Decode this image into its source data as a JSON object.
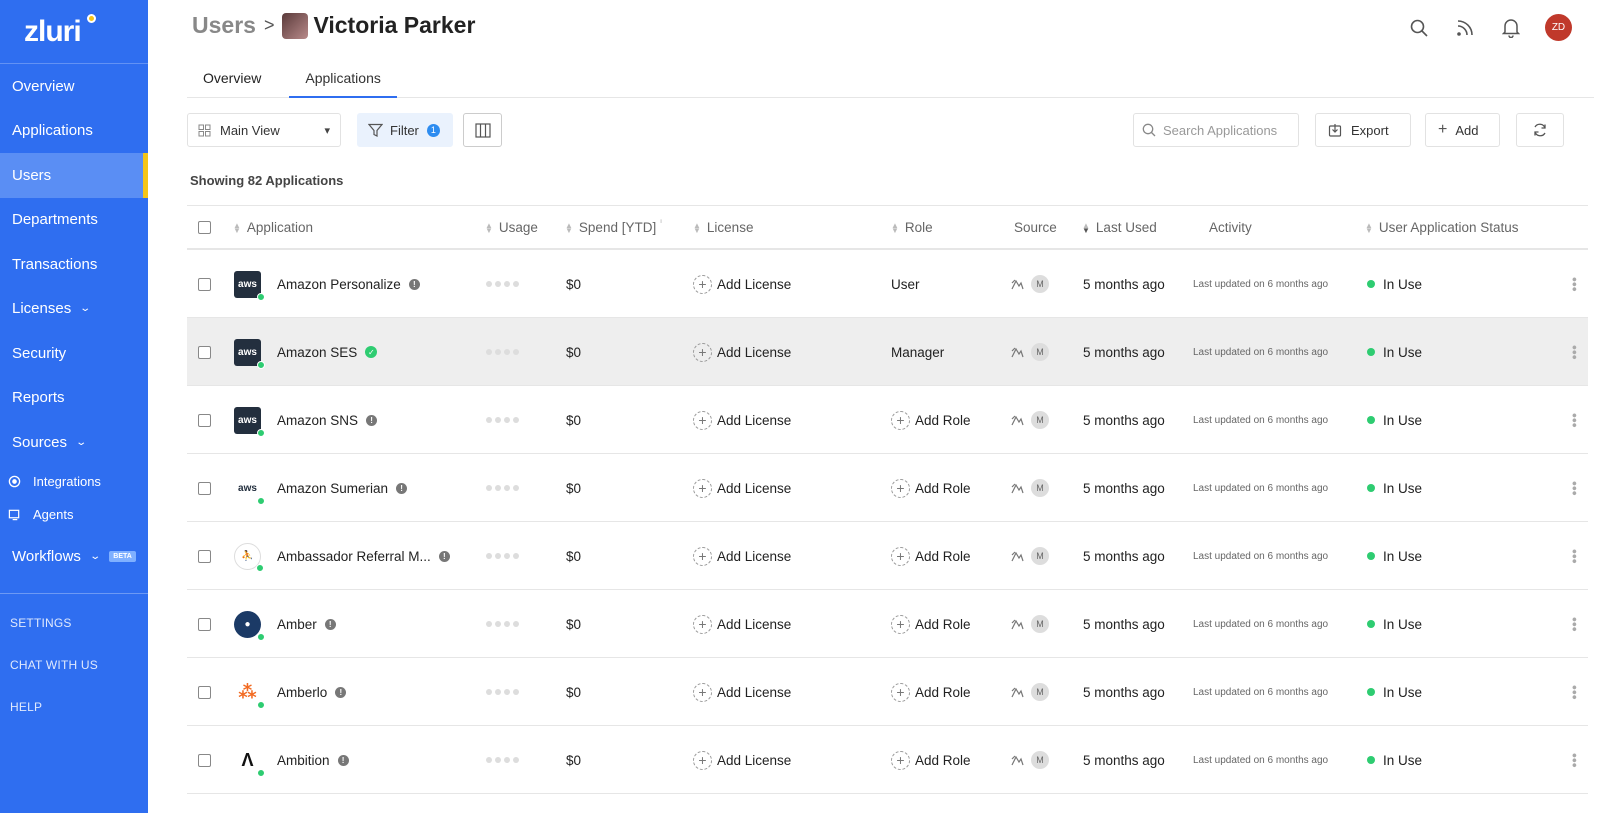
{
  "app": {
    "logo_text": "zluri"
  },
  "sidebar": {
    "items": [
      {
        "label": "Overview"
      },
      {
        "label": "Applications"
      },
      {
        "label": "Users"
      },
      {
        "label": "Departments"
      },
      {
        "label": "Transactions"
      },
      {
        "label": "Licenses"
      },
      {
        "label": "Security"
      },
      {
        "label": "Reports"
      },
      {
        "label": "Sources"
      }
    ],
    "sub_items": [
      {
        "label": "Integrations"
      },
      {
        "label": "Agents"
      }
    ],
    "workflows": {
      "label": "Workflows",
      "badge": "BETA"
    },
    "footer": [
      {
        "label": "SETTINGS"
      },
      {
        "label": "CHAT WITH US"
      },
      {
        "label": "HELP"
      }
    ]
  },
  "header": {
    "breadcrumb_root": "Users",
    "breadcrumb_sep": ">",
    "user_name": "Victoria Parker",
    "avatar_initials": "ZD"
  },
  "tabs": [
    {
      "label": "Overview"
    },
    {
      "label": "Applications"
    }
  ],
  "toolbar": {
    "view_label": "Main View",
    "filter_label": "Filter",
    "filter_count": "1",
    "search_placeholder": "Search Applications",
    "export_label": "Export",
    "add_label": "Add"
  },
  "showing_text": "Showing 82 Applications",
  "table": {
    "headers": {
      "application": "Application",
      "usage": "Usage",
      "spend": "Spend [YTD]",
      "license": "License",
      "role": "Role",
      "source": "Source",
      "last_used": "Last Used",
      "activity": "Activity",
      "status": "User Application Status"
    },
    "rows": [
      {
        "logo": "aws",
        "name": "Amazon Personalize",
        "badge": "info",
        "spend": "$0",
        "license": "Add License",
        "role": "User",
        "role_is_add": false,
        "src_m": "M",
        "last_used": "5 months ago",
        "activity": "Last updated on 6 months ago",
        "status": "In Use"
      },
      {
        "logo": "aws",
        "name": "Amazon SES",
        "badge": "verified",
        "spend": "$0",
        "license": "Add License",
        "role": "Manager",
        "role_is_add": false,
        "src_m": "M",
        "last_used": "5 months ago",
        "activity": "Last updated on 6 months ago",
        "status": "In Use"
      },
      {
        "logo": "aws",
        "name": "Amazon SNS",
        "badge": "info",
        "spend": "$0",
        "license": "Add License",
        "role": "Add Role",
        "role_is_add": true,
        "src_m": "M",
        "last_used": "5 months ago",
        "activity": "Last updated on 6 months ago",
        "status": "In Use"
      },
      {
        "logo": "aws",
        "name": "Amazon Sumerian",
        "badge": "info",
        "spend": "$0",
        "license": "Add License",
        "role": "Add Role",
        "role_is_add": true,
        "src_m": "M",
        "last_used": "5 months ago",
        "activity": "Last updated on 6 months ago",
        "status": "In Use"
      },
      {
        "logo": "ambassador",
        "name": "Ambassador Referral M...",
        "badge": "info",
        "spend": "$0",
        "license": "Add License",
        "role": "Add Role",
        "role_is_add": true,
        "src_m": "M",
        "last_used": "5 months ago",
        "activity": "Last updated on 6 months ago",
        "status": "In Use"
      },
      {
        "logo": "amber",
        "name": "Amber",
        "badge": "info",
        "spend": "$0",
        "license": "Add License",
        "role": "Add Role",
        "role_is_add": true,
        "src_m": "M",
        "last_used": "5 months ago",
        "activity": "Last updated on 6 months ago",
        "status": "In Use"
      },
      {
        "logo": "amberlo",
        "name": "Amberlo",
        "badge": "info",
        "spend": "$0",
        "license": "Add License",
        "role": "Add Role",
        "role_is_add": true,
        "src_m": "M",
        "last_used": "5 months ago",
        "activity": "Last updated on 6 months ago",
        "status": "In Use"
      },
      {
        "logo": "ambition",
        "name": "Ambition",
        "badge": "info",
        "spend": "$0",
        "license": "Add License",
        "role": "Add Role",
        "role_is_add": true,
        "src_m": "M",
        "last_used": "5 months ago",
        "activity": "Last updated on 6 months ago",
        "status": "In Use"
      }
    ]
  },
  "colors": {
    "sidebar": "#2f6ef0",
    "accent": "#f5c518",
    "status_green": "#2ecc71"
  }
}
